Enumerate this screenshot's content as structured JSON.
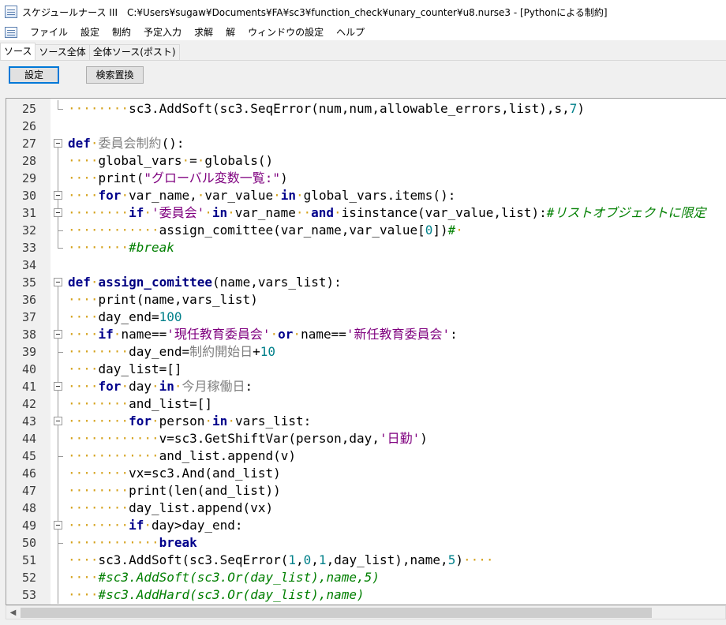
{
  "window": {
    "title": "スケジュールナース III　C:¥Users¥sugaw¥Documents¥FA¥sc3¥function_check¥unary_counter¥u8.nurse3 - [Pythonによる制約]"
  },
  "menu": {
    "items": [
      "ファイル",
      "設定",
      "制約",
      "予定入力",
      "求解",
      "解",
      "ウィンドウの設定",
      "ヘルプ"
    ]
  },
  "tabs": [
    {
      "label": "ソース",
      "active": true
    },
    {
      "label": "ソース全体",
      "active": false
    },
    {
      "label": "全体ソース(ポスト)",
      "active": false
    }
  ],
  "toolbar": {
    "settings_label": "設定",
    "search_replace_label": "検索置換"
  },
  "editor": {
    "lines": [
      {
        "n": "25",
        "fold": "end",
        "segs": [
          [
            "ws",
            "········"
          ],
          [
            "t",
            "sc3.AddSoft(sc3.SeqError(num,num,allowable_errors,list),s,"
          ],
          [
            "num",
            "7"
          ],
          [
            "t",
            ")"
          ]
        ]
      },
      {
        "n": "26",
        "fold": "",
        "segs": []
      },
      {
        "n": "27",
        "fold": "open",
        "segs": [
          [
            "kw",
            "def"
          ],
          [
            "ws",
            "·"
          ],
          [
            "jp",
            "委員会制約"
          ],
          [
            "t",
            "():"
          ]
        ]
      },
      {
        "n": "28",
        "fold": "cont",
        "segs": [
          [
            "ws",
            "····"
          ],
          [
            "t",
            "global_vars"
          ],
          [
            "ws",
            "·"
          ],
          [
            "t",
            "="
          ],
          [
            "ws",
            "·"
          ],
          [
            "t",
            "globals()"
          ]
        ]
      },
      {
        "n": "29",
        "fold": "cont",
        "segs": [
          [
            "ws",
            "····"
          ],
          [
            "t",
            "print("
          ],
          [
            "str",
            "\"グローバル変数一覧:\""
          ],
          [
            "t",
            ")"
          ]
        ]
      },
      {
        "n": "30",
        "fold": "open",
        "segs": [
          [
            "ws",
            "····"
          ],
          [
            "kw",
            "for"
          ],
          [
            "ws",
            "·"
          ],
          [
            "t",
            "var_name,"
          ],
          [
            "ws",
            "·"
          ],
          [
            "t",
            "var_value"
          ],
          [
            "ws",
            "·"
          ],
          [
            "kw",
            "in"
          ],
          [
            "ws",
            "·"
          ],
          [
            "t",
            "global_vars.items():"
          ]
        ]
      },
      {
        "n": "31",
        "fold": "open",
        "segs": [
          [
            "ws",
            "········"
          ],
          [
            "kw",
            "if"
          ],
          [
            "ws",
            "·"
          ],
          [
            "str",
            "'委員会'"
          ],
          [
            "ws",
            "·"
          ],
          [
            "kw",
            "in"
          ],
          [
            "ws",
            "·"
          ],
          [
            "t",
            "var_name"
          ],
          [
            "ws",
            "··"
          ],
          [
            "kw",
            "and"
          ],
          [
            "ws",
            "·"
          ],
          [
            "t",
            "isinstance(var_value,list):"
          ],
          [
            "cm",
            "#リストオブジェクトに限定"
          ]
        ]
      },
      {
        "n": "32",
        "fold": "end",
        "segs": [
          [
            "ws",
            "············"
          ],
          [
            "t",
            "assign_comittee(var_name,var_value["
          ],
          [
            "num",
            "0"
          ],
          [
            "t",
            "])"
          ],
          [
            "cm",
            "#"
          ],
          [
            "ws",
            "·"
          ]
        ]
      },
      {
        "n": "33",
        "fold": "end",
        "segs": [
          [
            "ws",
            "········"
          ],
          [
            "cm",
            "#break"
          ]
        ]
      },
      {
        "n": "34",
        "fold": "",
        "segs": []
      },
      {
        "n": "35",
        "fold": "open",
        "segs": [
          [
            "kw",
            "def"
          ],
          [
            "ws",
            "·"
          ],
          [
            "fn",
            "assign_comittee"
          ],
          [
            "t",
            "(name,vars_list):"
          ]
        ]
      },
      {
        "n": "36",
        "fold": "cont",
        "segs": [
          [
            "ws",
            "····"
          ],
          [
            "t",
            "print(name,vars_list)"
          ]
        ]
      },
      {
        "n": "37",
        "fold": "cont",
        "segs": [
          [
            "ws",
            "····"
          ],
          [
            "t",
            "day_end="
          ],
          [
            "num",
            "100"
          ]
        ]
      },
      {
        "n": "38",
        "fold": "open",
        "segs": [
          [
            "ws",
            "····"
          ],
          [
            "kw",
            "if"
          ],
          [
            "ws",
            "·"
          ],
          [
            "t",
            "name=="
          ],
          [
            "str",
            "'現任教育委員会'"
          ],
          [
            "ws",
            "·"
          ],
          [
            "kw",
            "or"
          ],
          [
            "ws",
            "·"
          ],
          [
            "t",
            "name=="
          ],
          [
            "str",
            "'新任教育委員会'"
          ],
          [
            "t",
            ":"
          ]
        ]
      },
      {
        "n": "39",
        "fold": "end",
        "segs": [
          [
            "ws",
            "········"
          ],
          [
            "t",
            "day_end="
          ],
          [
            "jp",
            "制約開始日"
          ],
          [
            "t",
            "+"
          ],
          [
            "num",
            "10"
          ]
        ]
      },
      {
        "n": "40",
        "fold": "cont",
        "segs": [
          [
            "ws",
            "····"
          ],
          [
            "t",
            "day_list=[]"
          ]
        ]
      },
      {
        "n": "41",
        "fold": "open",
        "segs": [
          [
            "ws",
            "····"
          ],
          [
            "kw",
            "for"
          ],
          [
            "ws",
            "·"
          ],
          [
            "t",
            "day"
          ],
          [
            "ws",
            "·"
          ],
          [
            "kw",
            "in"
          ],
          [
            "ws",
            "·"
          ],
          [
            "jp",
            "今月稼働日"
          ],
          [
            "t",
            ":"
          ]
        ]
      },
      {
        "n": "42",
        "fold": "cont",
        "segs": [
          [
            "ws",
            "········"
          ],
          [
            "t",
            "and_list=[]"
          ]
        ]
      },
      {
        "n": "43",
        "fold": "open",
        "segs": [
          [
            "ws",
            "········"
          ],
          [
            "kw",
            "for"
          ],
          [
            "ws",
            "·"
          ],
          [
            "t",
            "person"
          ],
          [
            "ws",
            "·"
          ],
          [
            "kw",
            "in"
          ],
          [
            "ws",
            "·"
          ],
          [
            "t",
            "vars_list:"
          ]
        ]
      },
      {
        "n": "44",
        "fold": "cont",
        "segs": [
          [
            "ws",
            "············"
          ],
          [
            "t",
            "v=sc3.GetShiftVar(person,day,"
          ],
          [
            "str",
            "'日勤'"
          ],
          [
            "t",
            ")"
          ]
        ]
      },
      {
        "n": "45",
        "fold": "end",
        "segs": [
          [
            "ws",
            "············"
          ],
          [
            "t",
            "and_list.append(v)"
          ]
        ]
      },
      {
        "n": "46",
        "fold": "cont",
        "segs": [
          [
            "ws",
            "········"
          ],
          [
            "t",
            "vx=sc3.And(and_list)"
          ]
        ]
      },
      {
        "n": "47",
        "fold": "cont",
        "segs": [
          [
            "ws",
            "········"
          ],
          [
            "t",
            "print(len(and_list))"
          ]
        ]
      },
      {
        "n": "48",
        "fold": "cont",
        "segs": [
          [
            "ws",
            "········"
          ],
          [
            "t",
            "day_list.append(vx)"
          ]
        ]
      },
      {
        "n": "49",
        "fold": "open",
        "segs": [
          [
            "ws",
            "········"
          ],
          [
            "kw",
            "if"
          ],
          [
            "ws",
            "·"
          ],
          [
            "t",
            "day>day_end:"
          ]
        ]
      },
      {
        "n": "50",
        "fold": "end",
        "segs": [
          [
            "ws",
            "············"
          ],
          [
            "kw",
            "break"
          ]
        ]
      },
      {
        "n": "51",
        "fold": "cont",
        "segs": [
          [
            "ws",
            "····"
          ],
          [
            "t",
            "sc3.AddSoft(sc3.SeqError("
          ],
          [
            "num",
            "1"
          ],
          [
            "t",
            ","
          ],
          [
            "num",
            "0"
          ],
          [
            "t",
            ","
          ],
          [
            "num",
            "1"
          ],
          [
            "t",
            ",day_list),name,"
          ],
          [
            "num",
            "5"
          ],
          [
            "t",
            ")"
          ],
          [
            "ws",
            "····"
          ]
        ]
      },
      {
        "n": "52",
        "fold": "cont",
        "segs": [
          [
            "ws",
            "····"
          ],
          [
            "cm",
            "#sc3.AddSoft(sc3.Or(day_list),name,5)"
          ]
        ]
      },
      {
        "n": "53",
        "fold": "cont",
        "segs": [
          [
            "ws",
            "····"
          ],
          [
            "cm",
            "#sc3.AddHard(sc3.Or(day_list),name)"
          ]
        ]
      }
    ]
  },
  "colors": {
    "keyword": "#00008b",
    "string": "#7f007f",
    "number": "#00808a",
    "comment": "#007f00",
    "whitespace_marker": "#d4a017"
  }
}
